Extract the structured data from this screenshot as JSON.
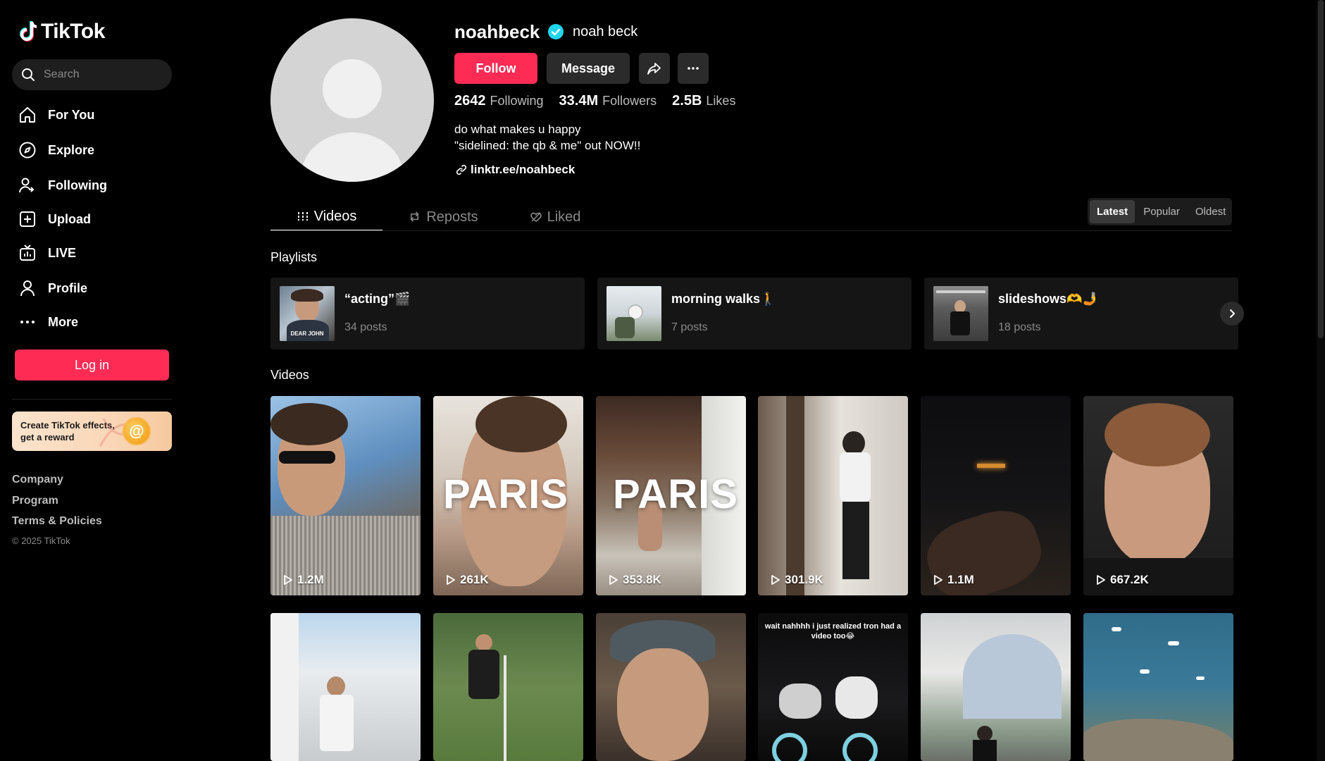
{
  "app": {
    "name": "TikTok"
  },
  "sidebar": {
    "search_placeholder": "Search",
    "nav": [
      {
        "label": "For You",
        "icon": "home-icon"
      },
      {
        "label": "Explore",
        "icon": "compass-icon"
      },
      {
        "label": "Following",
        "icon": "following-icon"
      },
      {
        "label": "Upload",
        "icon": "upload-icon"
      },
      {
        "label": "LIVE",
        "icon": "live-icon"
      },
      {
        "label": "Profile",
        "icon": "profile-icon"
      },
      {
        "label": "More",
        "icon": "more-icon"
      }
    ],
    "login_label": "Log in",
    "promo_text": "Create TikTok effects, get a reward",
    "footer_links": [
      "Company",
      "Program",
      "Terms & Policies"
    ],
    "copyright": "© 2025 TikTok"
  },
  "profile": {
    "username": "noahbeck",
    "nickname": "noah beck",
    "verified": true,
    "follow_label": "Follow",
    "message_label": "Message",
    "stats": [
      {
        "num": "2642",
        "label": "Following"
      },
      {
        "num": "33.4M",
        "label": "Followers"
      },
      {
        "num": "2.5B",
        "label": "Likes"
      }
    ],
    "bio_line1": "do what makes u happy",
    "bio_line2": "\"sidelined: the qb & me\" out NOW!!",
    "link": "linktr.ee/noahbeck"
  },
  "tabs": {
    "videos": "Videos",
    "reposts": "Reposts",
    "liked": "Liked",
    "active": "videos"
  },
  "sort": {
    "options": [
      "Latest",
      "Popular",
      "Oldest"
    ],
    "active": "Latest"
  },
  "playlists": {
    "title": "Playlists",
    "items": [
      {
        "title": "“acting”🎬",
        "count": "34 posts",
        "thumb_text": "DEAR JOHN"
      },
      {
        "title": "morning walks🚶",
        "count": "7 posts",
        "thumb_text": ""
      },
      {
        "title": "slideshows🫶🤳",
        "count": "18 posts",
        "thumb_text": ""
      }
    ]
  },
  "videos": {
    "title": "Videos",
    "items": [
      {
        "views": "1.2M",
        "overlay": ""
      },
      {
        "views": "261K",
        "overlay": "PARIS"
      },
      {
        "views": "353.8K",
        "overlay": "PARIS"
      },
      {
        "views": "301.9K",
        "overlay": ""
      },
      {
        "views": "1.1M",
        "overlay": ""
      },
      {
        "views": "667.2K",
        "overlay": ""
      },
      {
        "views": "",
        "overlay": ""
      },
      {
        "views": "",
        "overlay": ""
      },
      {
        "views": "",
        "overlay": ""
      },
      {
        "views": "",
        "overlay": "",
        "caption": "wait nahhhh i just realized tron had a video too😂"
      },
      {
        "views": "",
        "overlay": ""
      },
      {
        "views": "",
        "overlay": ""
      }
    ]
  },
  "colors": {
    "accent": "#fe2c55",
    "verified": "#20d5ec",
    "background": "#000000"
  }
}
